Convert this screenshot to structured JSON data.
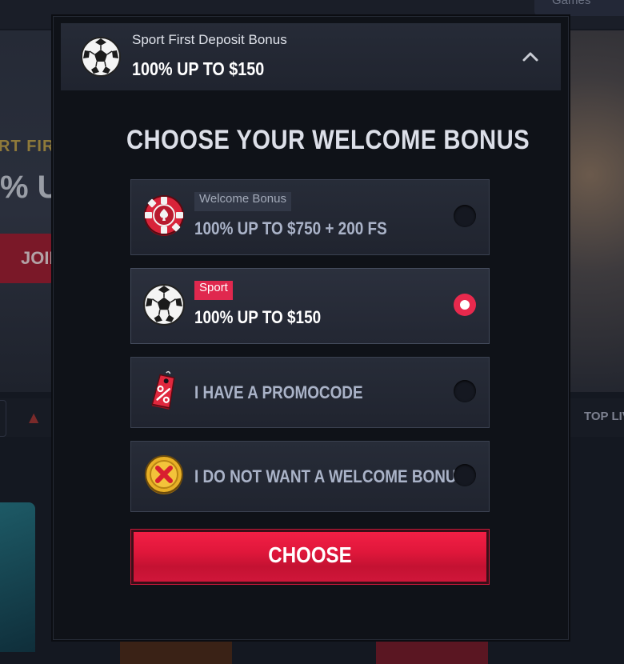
{
  "background": {
    "search_label": "Games",
    "hero_line1": "RT FIRST",
    "hero_line2": "% UP",
    "hero_button": "JOIN",
    "tab_right_label": "TOP LIV"
  },
  "header": {
    "subtitle": "Sport First Deposit Bonus",
    "title": "100% UP TO $150"
  },
  "heading": "CHOOSE YOUR WELCOME BONUS",
  "options": [
    {
      "badge": "Welcome Bonus",
      "title": "100% UP TO $750 + 200 FS",
      "icon": "poker-chip-icon",
      "selected": false
    },
    {
      "badge": "Sport",
      "title": "100% UP TO $150",
      "icon": "soccer-ball-icon",
      "selected": true
    },
    {
      "badge": "",
      "title": "I HAVE A PROMOCODE",
      "icon": "promo-tag-icon",
      "selected": false
    },
    {
      "badge": "",
      "title": "I DO NOT WANT A WELCOME BONUS",
      "icon": "no-bonus-coin-icon",
      "selected": false
    }
  ],
  "button_label": "CHOOSE",
  "colors": {
    "accent": "#e8294d",
    "modal_bg": "#0f1218",
    "option_bg": "#252a36"
  }
}
